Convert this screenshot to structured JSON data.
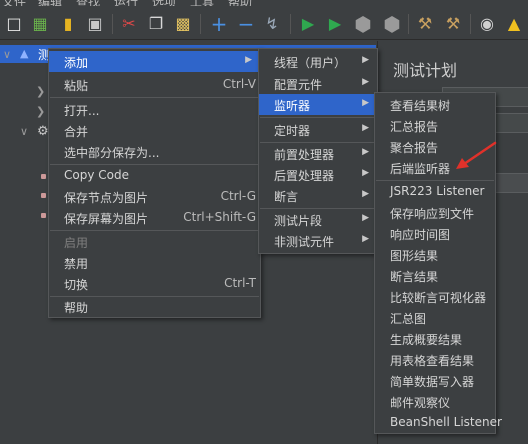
{
  "menubar": {
    "items": [
      "文件",
      "编辑",
      "查找",
      "运行",
      "选项",
      "工具",
      "帮助"
    ]
  },
  "tree": {
    "selected_label": "测"
  },
  "right_pane": {
    "title": "测试计划"
  },
  "context_menu": {
    "items": [
      {
        "label": "添加",
        "accel": "",
        "submenu": true,
        "selected": true
      },
      {
        "label": "粘贴",
        "accel": "Ctrl-V"
      },
      {
        "label": "打开..."
      },
      {
        "label": "合并"
      },
      {
        "label": "选中部分保存为..."
      },
      {
        "label": "Copy Code"
      },
      {
        "label": "保存节点为图片",
        "accel": "Ctrl-G"
      },
      {
        "label": "保存屏幕为图片",
        "accel": "Ctrl+Shift-G"
      },
      {
        "label": "启用",
        "disabled": true
      },
      {
        "label": "禁用"
      },
      {
        "label": "切换",
        "accel": "Ctrl-T"
      },
      {
        "label": "帮助"
      }
    ]
  },
  "add_submenu": {
    "items": [
      {
        "label": "线程（用户）"
      },
      {
        "label": "配置元件"
      },
      {
        "label": "监听器",
        "selected": true
      },
      {
        "label": "定时器"
      },
      {
        "label": "前置处理器"
      },
      {
        "label": "后置处理器"
      },
      {
        "label": "断言"
      },
      {
        "label": "测试片段"
      },
      {
        "label": "非测试元件"
      }
    ]
  },
  "listener_submenu": {
    "items": [
      {
        "label": "查看结果树"
      },
      {
        "label": "汇总报告"
      },
      {
        "label": "聚合报告"
      },
      {
        "label": "后端监听器"
      },
      {
        "label": "JSR223 Listener"
      },
      {
        "label": "保存响应到文件"
      },
      {
        "label": "响应时间图"
      },
      {
        "label": "图形结果"
      },
      {
        "label": "断言结果"
      },
      {
        "label": "比较断言可视化器"
      },
      {
        "label": "汇总图"
      },
      {
        "label": "生成概要结果"
      },
      {
        "label": "用表格查看结果"
      },
      {
        "label": "简单数据写入器"
      },
      {
        "label": "邮件观察仪"
      },
      {
        "label": "BeanShell Listener"
      }
    ]
  },
  "colors": {
    "selection": "#2f65ca",
    "background": "#3c3f41",
    "annotation_arrow": "#e0312a"
  }
}
